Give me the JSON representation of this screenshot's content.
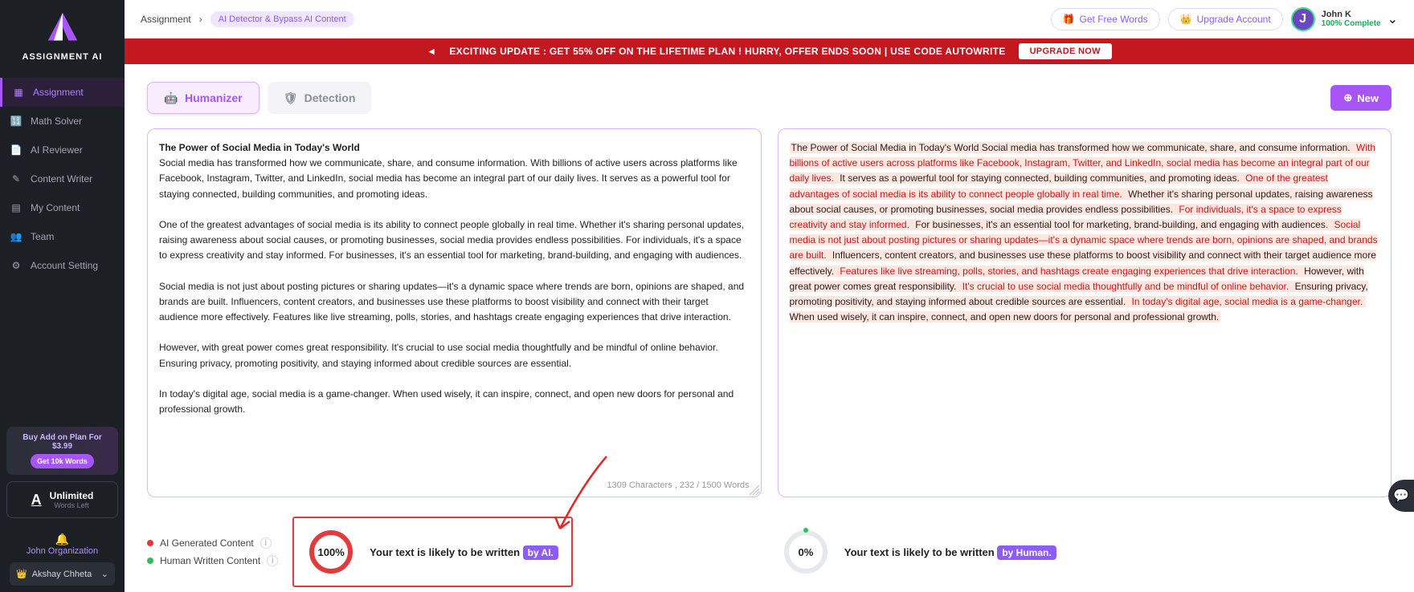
{
  "brand": "ASSIGNMENT AI",
  "sidebar": {
    "items": [
      {
        "label": "Assignment"
      },
      {
        "label": "Math Solver"
      },
      {
        "label": "AI Reviewer"
      },
      {
        "label": "Content Writer"
      },
      {
        "label": "My Content"
      },
      {
        "label": "Team"
      },
      {
        "label": "Account Setting"
      }
    ],
    "addon_title": "Buy Add on Plan For $3.99",
    "addon_btn": "Get 10k Words",
    "unlimited_title": "Unlimited",
    "unlimited_sub": "Words Left",
    "org": "John Organization",
    "user_chip": "Akshay Chheta"
  },
  "breadcrumb": {
    "root": "Assignment",
    "current": "AI Detector & Bypass AI Content"
  },
  "topbar": {
    "free_words": "Get Free Words",
    "upgrade": "Upgrade Account",
    "user_name": "John K",
    "user_complete": "100% Complete",
    "avatar_letter": "J"
  },
  "banner": {
    "text": "EXCITING UPDATE : GET 55% OFF ON THE LIFETIME PLAN ! HURRY, OFFER ENDS SOON | USE CODE AUTOWRITE",
    "cta": "UPGRADE NOW"
  },
  "tabs": {
    "humanizer": "Humanizer",
    "detection": "Detection",
    "new_btn": "New"
  },
  "input_title": "The Power of Social Media in Today's World",
  "input_p1": "Social media has transformed how we communicate, share, and consume information. With billions of active users across platforms like Facebook, Instagram, Twitter, and LinkedIn, social media has become an integral part of our daily lives. It serves as a powerful tool for staying connected, building communities, and promoting ideas.",
  "input_p2": "One of the greatest advantages of social media is its ability to connect people globally in real time. Whether it's sharing personal updates, raising awareness about social causes, or promoting businesses, social media provides endless possibilities. For individuals, it's a space to express creativity and stay informed. For businesses, it's an essential tool for marketing, brand-building, and engaging with audiences.",
  "input_p3": "Social media is not just about posting pictures or sharing updates—it's a dynamic space where trends are born, opinions are shaped, and brands are built. Influencers, content creators, and businesses use these platforms to boost visibility and connect with their target audience more effectively. Features like live streaming, polls, stories, and hashtags create engaging experiences that drive interaction.",
  "input_p4": "However, with great power comes great responsibility. It's crucial to use social media thoughtfully and be mindful of online behavior. Ensuring privacy, promoting positivity, and staying informed about credible sources are essential.",
  "input_p5": "In today's digital age, social media is a game-changer. When used wisely, it can inspire, connect, and open new doors for personal and professional growth.",
  "counter": "1309 Characters , 232 / 1500 Words",
  "out_s1": "The Power of Social Media in Today's World Social media has transformed how we communicate, share, and consume information.",
  "out_s2": " With billions of active users across platforms like Facebook, Instagram, Twitter, and LinkedIn, social media has become an integral part of our daily lives.",
  "out_s3": " It serves as a powerful tool for staying connected, building communities, and promoting ideas.",
  "out_s4": " One of the greatest advantages of social media is its ability to connect people globally in real time.",
  "out_s5": " Whether it's sharing personal updates, raising awareness about social causes, or promoting businesses, social media provides endless possibilities.",
  "out_s6": " For individuals, it's a space to express creativity and stay informed.",
  "out_s7": " For businesses, it's an essential tool for marketing, brand-building, and engaging with audiences.",
  "out_s8": " Social media is not just about posting pictures or sharing updates—it's a dynamic space where trends are born, opinions are shaped, and brands are built.",
  "out_s9": " Influencers, content creators, and businesses use these platforms to boost visibility and connect with their target audience more effectively.",
  "out_s10": " Features like live streaming, polls, stories, and hashtags create engaging experiences that drive interaction.",
  "out_s11": " However, with great power comes great responsibility.",
  "out_s12": " It's crucial to use social media thoughtfully and be mindful of online behavior.",
  "out_s13": " Ensuring privacy, promoting positivity, and staying informed about credible sources are essential.",
  "out_s14": " In today's digital age, social media is a game-changer.",
  "out_s15": " When used wisely, it can inspire, connect, and open new doors for personal and professional growth.",
  "legend": {
    "ai": "AI Generated Content",
    "human": "Human Written Content"
  },
  "result_left": {
    "pct": "100%",
    "text": "Your text is likely to be written ",
    "badge": "by AI."
  },
  "result_right": {
    "pct": "0%",
    "text": "Your text is likely to be written ",
    "badge": "by Human."
  }
}
